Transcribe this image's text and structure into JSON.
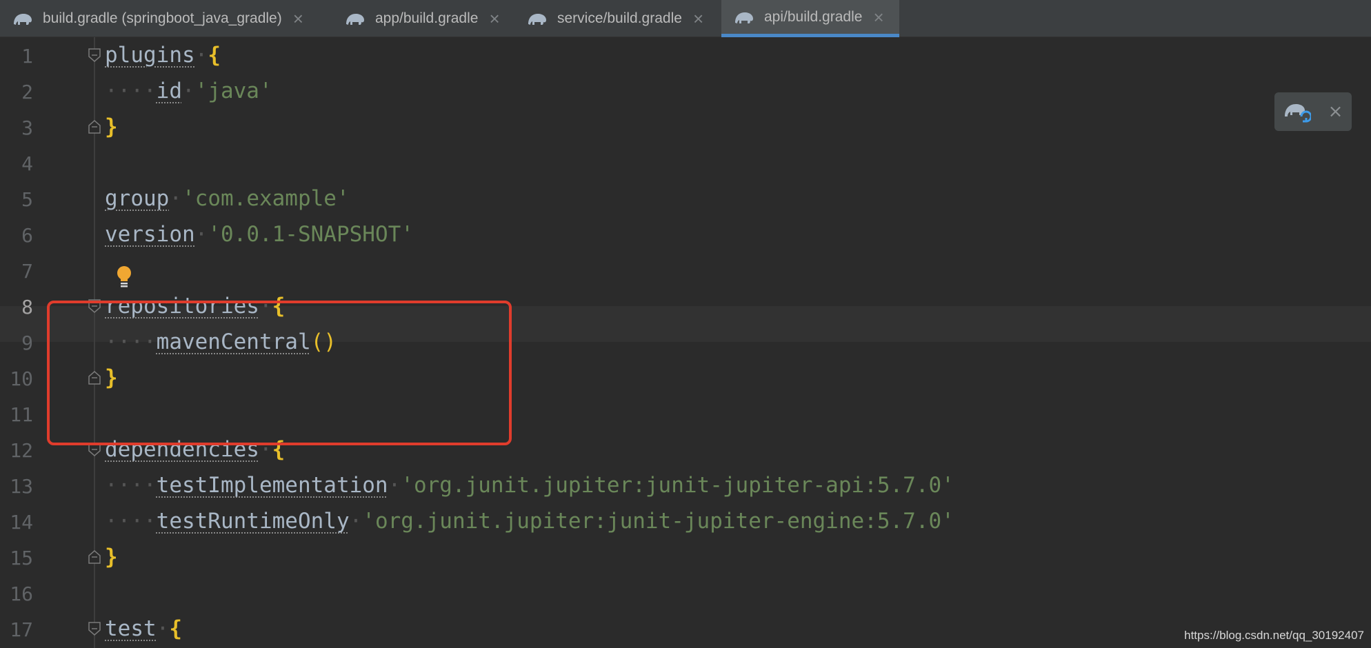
{
  "tabs": [
    {
      "label": "build.gradle (springboot_java_gradle)",
      "icon": "gradle-elephant-icon",
      "active": false
    },
    {
      "label": "app/build.gradle",
      "icon": "gradle-elephant-icon",
      "active": false
    },
    {
      "label": "service/build.gradle",
      "icon": "gradle-elephant-icon",
      "active": false
    },
    {
      "label": "api/build.gradle",
      "icon": "gradle-elephant-icon",
      "active": true
    }
  ],
  "editor": {
    "current_line": 8,
    "line_numbers": [
      "1",
      "2",
      "3",
      "4",
      "5",
      "6",
      "7",
      "8",
      "9",
      "10",
      "11",
      "12",
      "13",
      "14",
      "15",
      "16",
      "17"
    ],
    "lines": [
      {
        "indent": "",
        "keyword": "plugins",
        "string": "",
        "brace": "{",
        "parens": ""
      },
      {
        "indent": "····",
        "keyword": "id",
        "string": "'java'",
        "brace": "",
        "parens": ""
      },
      {
        "indent": "",
        "keyword": "",
        "string": "",
        "brace": "}",
        "parens": ""
      },
      {
        "indent": "",
        "keyword": "",
        "string": "",
        "brace": "",
        "parens": ""
      },
      {
        "indent": "",
        "keyword": "group",
        "string": "'com.example'",
        "brace": "",
        "parens": ""
      },
      {
        "indent": "",
        "keyword": "version",
        "string": "'0.0.1-SNAPSHOT'",
        "brace": "",
        "parens": ""
      },
      {
        "indent": "",
        "keyword": "",
        "string": "",
        "brace": "",
        "parens": ""
      },
      {
        "indent": "",
        "keyword": "repositories",
        "string": "",
        "brace": "{",
        "parens": ""
      },
      {
        "indent": "····",
        "keyword": "mavenCentral",
        "string": "",
        "brace": "",
        "parens": "()"
      },
      {
        "indent": "",
        "keyword": "",
        "string": "",
        "brace": "}",
        "parens": ""
      },
      {
        "indent": "",
        "keyword": "",
        "string": "",
        "brace": "",
        "parens": ""
      },
      {
        "indent": "",
        "keyword": "dependencies",
        "string": "",
        "brace": "{",
        "parens": ""
      },
      {
        "indent": "····",
        "keyword": "testImplementation",
        "string": "'org.junit.jupiter:junit-jupiter-api:5.7.0'",
        "brace": "",
        "parens": ""
      },
      {
        "indent": "····",
        "keyword": "testRuntimeOnly",
        "string": "'org.junit.jupiter:junit-jupiter-engine:5.7.0'",
        "brace": "",
        "parens": ""
      },
      {
        "indent": "",
        "keyword": "",
        "string": "",
        "brace": "}",
        "parens": ""
      },
      {
        "indent": "",
        "keyword": "",
        "string": "",
        "brace": "",
        "parens": ""
      },
      {
        "indent": "",
        "keyword": "test",
        "string": "",
        "brace": "{",
        "parens": ""
      }
    ]
  },
  "sync_popup": {
    "icon": "gradle-sync-icon",
    "close_icon": "close-icon"
  },
  "watermark": "https://blog.csdn.net/qq_30192407",
  "colors": {
    "background": "#2b2b2b",
    "tab_active_underline": "#4a88c7",
    "string": "#6a8759",
    "brace": "#e8bf2a",
    "highlight_box": "#e03c2c"
  }
}
